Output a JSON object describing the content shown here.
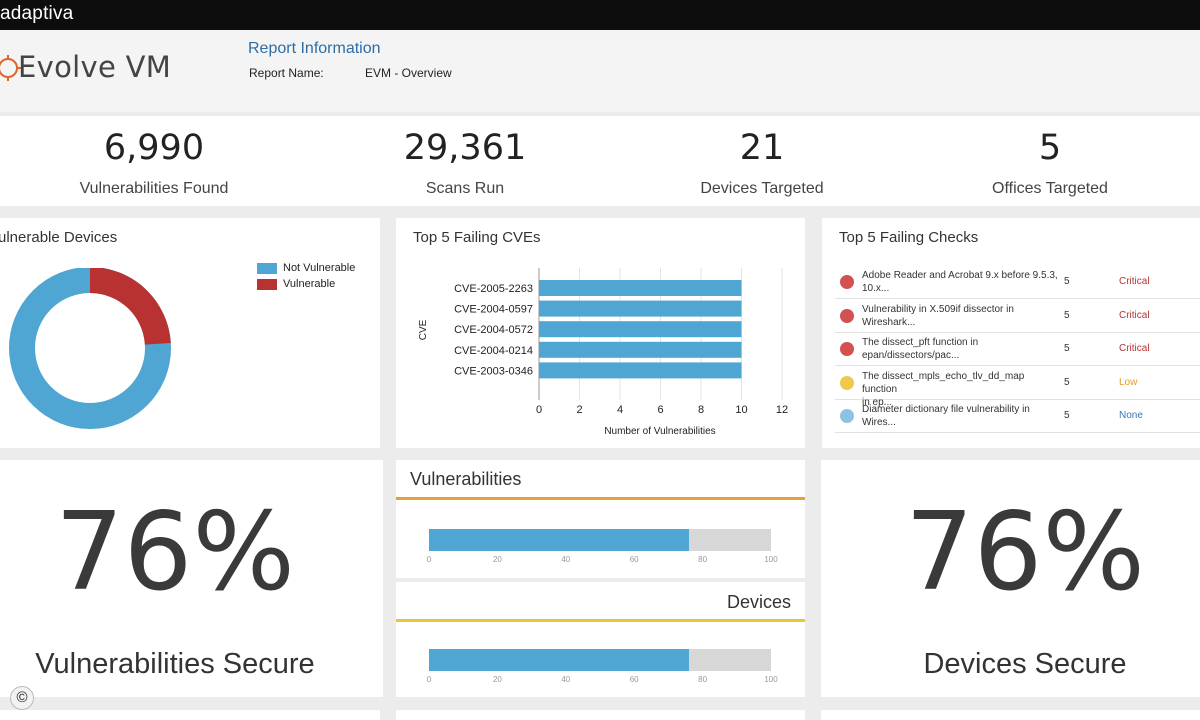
{
  "brand": "adaptiva",
  "header": {
    "app_title": "Evolve VM",
    "report_heading": "Report Information",
    "report_name_label": "Report Name:",
    "report_name_value": "EVM - Overview"
  },
  "kpis": [
    {
      "value": "6,990",
      "label": "Vulnerabilities Found"
    },
    {
      "value": "29,361",
      "label": "Scans Run"
    },
    {
      "value": "21",
      "label": "Devices Targeted"
    },
    {
      "value": "5",
      "label": "Offices Targeted"
    }
  ],
  "vulnerable_devices": {
    "title": "ulnerable Devices",
    "legend": [
      {
        "label": "Not Vulnerable",
        "color": "#4fa6d3"
      },
      {
        "label": "Vulnerable",
        "color": "#b83232"
      }
    ],
    "share_vulnerable": 0.24
  },
  "failing_cves": {
    "title": "Top 5 Failing CVEs"
  },
  "chart_data": {
    "type": "bar",
    "orientation": "horizontal",
    "categories": [
      "CVE-2005-2263",
      "CVE-2004-0597",
      "CVE-2004-0572",
      "CVE-2004-0214",
      "CVE-2003-0346"
    ],
    "values": [
      10,
      10,
      10,
      10,
      10
    ],
    "xlabel": "Number of Vulnerabilities",
    "ylabel": "CVE",
    "xlim": [
      0,
      12
    ],
    "xticks": [
      "0",
      "2",
      "4",
      "6",
      "8",
      "10",
      "12"
    ],
    "bar_color": "#4fa6d3",
    "grid": "vertical"
  },
  "failing_checks": {
    "title": "Top 5 Failing Checks",
    "rows": [
      {
        "line1": "Adobe Reader and Acrobat 9.x before 9.5.3,",
        "line2": "10.x...",
        "count": "5",
        "severity": "Critical",
        "dot": "#d25252",
        "sev_color": "#b83232"
      },
      {
        "line1": "Vulnerability in X.509if dissector in",
        "line2": "Wireshark...",
        "count": "5",
        "severity": "Critical",
        "dot": "#d25252",
        "sev_color": "#b83232"
      },
      {
        "line1": "The dissect_pft function in",
        "line2": "epan/dissectors/pac...",
        "count": "5",
        "severity": "Critical",
        "dot": "#d25252",
        "sev_color": "#b83232"
      },
      {
        "line1": "The dissect_mpls_echo_tlv_dd_map function",
        "line2": "in ep...",
        "count": "5",
        "severity": "Low",
        "dot": "#f1c84b",
        "sev_color": "#e39b2a"
      },
      {
        "line1": "Diameter dictionary file vulnerability in",
        "line2": "Wires...",
        "count": "5",
        "severity": "None",
        "dot": "#8ac4e0",
        "sev_color": "#3a79b0"
      }
    ]
  },
  "vuln_secure": {
    "value": "76%",
    "label": "Vulnerabilities Secure"
  },
  "device_secure": {
    "value": "76%",
    "label": "Devices Secure"
  },
  "progress": {
    "vulnerabilities": {
      "title": "Vulnerabilities",
      "percent": 76,
      "line_color": "#e6a23a"
    },
    "devices": {
      "title": "Devices",
      "percent": 76,
      "line_color": "#e8c83a"
    },
    "ticks": [
      "0",
      "20",
      "40",
      "60",
      "80",
      "100"
    ]
  },
  "copyright": "©"
}
